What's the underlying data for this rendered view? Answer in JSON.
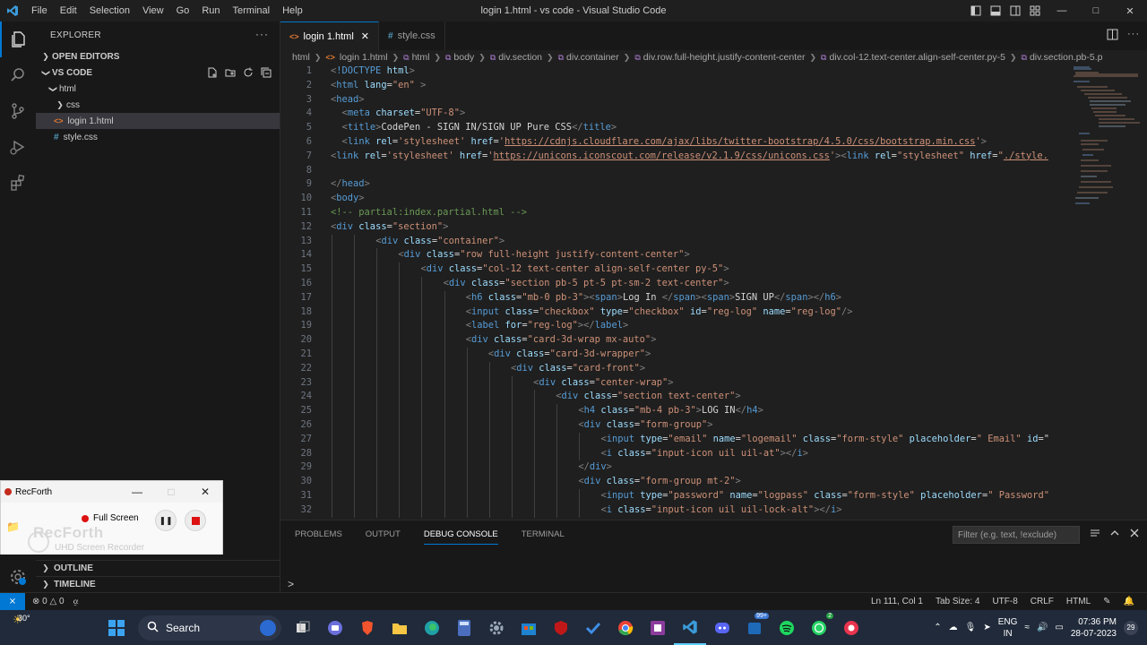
{
  "titlebar": {
    "menu": [
      "File",
      "Edit",
      "Selection",
      "View",
      "Go",
      "Run",
      "Terminal",
      "Help"
    ],
    "title": "login 1.html - vs code - Visual Studio Code"
  },
  "sidebar": {
    "header": "EXPLORER",
    "open_editors": "OPEN EDITORS",
    "folder": "VS CODE",
    "tree": [
      {
        "label": "html",
        "indent": 1,
        "kind": "folder-open"
      },
      {
        "label": "css",
        "indent": 2,
        "kind": "folder-closed"
      },
      {
        "label": "login 1.html",
        "indent": 2,
        "kind": "html"
      },
      {
        "label": "style.css",
        "indent": 1,
        "kind": "css"
      }
    ],
    "outline": "OUTLINE",
    "timeline": "TIMELINE"
  },
  "tabs": [
    {
      "label": "login 1.html",
      "icon": "html",
      "active": true
    },
    {
      "label": "style.css",
      "icon": "css",
      "active": false
    }
  ],
  "breadcrumb": [
    "html",
    "login 1.html",
    "html",
    "body",
    "div.section",
    "div.container",
    "div.row.full-height.justify-content-center",
    "div.col-12.text-center.align-self-center.py-5",
    "div.section.pb-5.p"
  ],
  "code_lines": [
    {
      "n": "1",
      "ind": 0,
      "tk": [
        [
          "p",
          "<"
        ],
        [
          "t",
          "!DOCTYPE "
        ],
        [
          "a",
          "html"
        ],
        [
          "p",
          ">"
        ]
      ]
    },
    {
      "n": "2",
      "ind": 0,
      "tk": [
        [
          "p",
          "<"
        ],
        [
          "t",
          "html "
        ],
        [
          "a",
          "lang"
        ],
        [
          "x",
          "="
        ],
        [
          "s",
          "\"en\""
        ],
        [
          "p",
          " >"
        ]
      ]
    },
    {
      "n": "3",
      "ind": 0,
      "tk": [
        [
          "p",
          "<"
        ],
        [
          "t",
          "head"
        ],
        [
          "p",
          ">"
        ]
      ]
    },
    {
      "n": "4",
      "ind": 1,
      "tk": [
        [
          "p",
          "<"
        ],
        [
          "t",
          "meta "
        ],
        [
          "a",
          "charset"
        ],
        [
          "x",
          "="
        ],
        [
          "s",
          "\"UTF-8\""
        ],
        [
          "p",
          ">"
        ]
      ]
    },
    {
      "n": "5",
      "ind": 1,
      "tk": [
        [
          "p",
          "<"
        ],
        [
          "t",
          "title"
        ],
        [
          "p",
          ">"
        ],
        [
          "x",
          "CodePen - SIGN IN/SIGN UP Pure CSS"
        ],
        [
          "p",
          "</"
        ],
        [
          "t",
          "title"
        ],
        [
          "p",
          ">"
        ]
      ]
    },
    {
      "n": "6",
      "ind": 1,
      "tk": [
        [
          "p",
          "<"
        ],
        [
          "t",
          "link "
        ],
        [
          "a",
          "rel"
        ],
        [
          "x",
          "="
        ],
        [
          "s",
          "'stylesheet' "
        ],
        [
          "a",
          "href"
        ],
        [
          "x",
          "="
        ],
        [
          "s",
          "'"
        ],
        [
          "u",
          "https://cdnjs.cloudflare.com/ajax/libs/twitter-bootstrap/4.5.0/css/bootstrap.min.css"
        ],
        [
          "s",
          "'"
        ],
        [
          "p",
          ">"
        ]
      ]
    },
    {
      "n": "7",
      "ind": 0,
      "tk": [
        [
          "p",
          "<"
        ],
        [
          "t",
          "link "
        ],
        [
          "a",
          "rel"
        ],
        [
          "x",
          "="
        ],
        [
          "s",
          "'stylesheet' "
        ],
        [
          "a",
          "href"
        ],
        [
          "x",
          "="
        ],
        [
          "s",
          "'"
        ],
        [
          "u",
          "https://unicons.iconscout.com/release/v2.1.9/css/unicons.css"
        ],
        [
          "s",
          "'"
        ],
        [
          "p",
          "><"
        ],
        [
          "t",
          "link "
        ],
        [
          "a",
          "rel"
        ],
        [
          "x",
          "="
        ],
        [
          "s",
          "\"stylesheet\" "
        ],
        [
          "a",
          "href"
        ],
        [
          "x",
          "="
        ],
        [
          "s",
          "\""
        ],
        [
          "u",
          "./style."
        ]
      ]
    },
    {
      "n": "8",
      "ind": 0,
      "tk": []
    },
    {
      "n": "9",
      "ind": 0,
      "tk": [
        [
          "p",
          "</"
        ],
        [
          "t",
          "head"
        ],
        [
          "p",
          ">"
        ]
      ]
    },
    {
      "n": "10",
      "ind": 0,
      "tk": [
        [
          "p",
          "<"
        ],
        [
          "t",
          "body"
        ],
        [
          "p",
          ">"
        ]
      ]
    },
    {
      "n": "11",
      "ind": 0,
      "tk": [
        [
          "c",
          "<!-- partial:index.partial.html -->"
        ]
      ]
    },
    {
      "n": "12",
      "ind": 0,
      "tk": [
        [
          "p",
          "<"
        ],
        [
          "t",
          "div "
        ],
        [
          "a",
          "class"
        ],
        [
          "x",
          "="
        ],
        [
          "s",
          "\"section\""
        ],
        [
          "p",
          ">"
        ]
      ]
    },
    {
      "n": "13",
      "ind": 4,
      "tk": [
        [
          "p",
          "<"
        ],
        [
          "t",
          "div "
        ],
        [
          "a",
          "class"
        ],
        [
          "x",
          "="
        ],
        [
          "s",
          "\"container\""
        ],
        [
          "p",
          ">"
        ]
      ]
    },
    {
      "n": "14",
      "ind": 6,
      "tk": [
        [
          "p",
          "<"
        ],
        [
          "t",
          "div "
        ],
        [
          "a",
          "class"
        ],
        [
          "x",
          "="
        ],
        [
          "s",
          "\"row full-height justify-content-center\""
        ],
        [
          "p",
          ">"
        ]
      ]
    },
    {
      "n": "15",
      "ind": 8,
      "tk": [
        [
          "p",
          "<"
        ],
        [
          "t",
          "div "
        ],
        [
          "a",
          "class"
        ],
        [
          "x",
          "="
        ],
        [
          "s",
          "\"col-12 text-center align-self-center py-5\""
        ],
        [
          "p",
          ">"
        ]
      ]
    },
    {
      "n": "16",
      "ind": 10,
      "tk": [
        [
          "p",
          "<"
        ],
        [
          "t",
          "div "
        ],
        [
          "a",
          "class"
        ],
        [
          "x",
          "="
        ],
        [
          "s",
          "\"section pb-5 pt-5 pt-sm-2 text-center\""
        ],
        [
          "p",
          ">"
        ]
      ]
    },
    {
      "n": "17",
      "ind": 12,
      "tk": [
        [
          "p",
          "<"
        ],
        [
          "t",
          "h6 "
        ],
        [
          "a",
          "class"
        ],
        [
          "x",
          "="
        ],
        [
          "s",
          "\"mb-0 pb-3\""
        ],
        [
          "p",
          "><"
        ],
        [
          "t",
          "span"
        ],
        [
          "p",
          ">"
        ],
        [
          "x",
          "Log In "
        ],
        [
          "p",
          "</"
        ],
        [
          "t",
          "span"
        ],
        [
          "p",
          "><"
        ],
        [
          "t",
          "span"
        ],
        [
          "p",
          ">"
        ],
        [
          "x",
          "SIGN UP"
        ],
        [
          "p",
          "</"
        ],
        [
          "t",
          "span"
        ],
        [
          "p",
          "></"
        ],
        [
          "t",
          "h6"
        ],
        [
          "p",
          ">"
        ]
      ]
    },
    {
      "n": "18",
      "ind": 12,
      "tk": [
        [
          "p",
          "<"
        ],
        [
          "t",
          "input "
        ],
        [
          "a",
          "class"
        ],
        [
          "x",
          "="
        ],
        [
          "s",
          "\"checkbox\" "
        ],
        [
          "a",
          "type"
        ],
        [
          "x",
          "="
        ],
        [
          "s",
          "\"checkbox\" "
        ],
        [
          "a",
          "id"
        ],
        [
          "x",
          "="
        ],
        [
          "s",
          "\"reg-log\" "
        ],
        [
          "a",
          "name"
        ],
        [
          "x",
          "="
        ],
        [
          "s",
          "\"reg-log\""
        ],
        [
          "p",
          "/>"
        ]
      ]
    },
    {
      "n": "19",
      "ind": 12,
      "tk": [
        [
          "p",
          "<"
        ],
        [
          "t",
          "label "
        ],
        [
          "a",
          "for"
        ],
        [
          "x",
          "="
        ],
        [
          "s",
          "\"reg-log\""
        ],
        [
          "p",
          "></"
        ],
        [
          "t",
          "label"
        ],
        [
          "p",
          ">"
        ]
      ]
    },
    {
      "n": "20",
      "ind": 12,
      "tk": [
        [
          "p",
          "<"
        ],
        [
          "t",
          "div "
        ],
        [
          "a",
          "class"
        ],
        [
          "x",
          "="
        ],
        [
          "s",
          "\"card-3d-wrap mx-auto\""
        ],
        [
          "p",
          ">"
        ]
      ]
    },
    {
      "n": "21",
      "ind": 14,
      "tk": [
        [
          "p",
          "<"
        ],
        [
          "t",
          "div "
        ],
        [
          "a",
          "class"
        ],
        [
          "x",
          "="
        ],
        [
          "s",
          "\"card-3d-wrapper\""
        ],
        [
          "p",
          ">"
        ]
      ]
    },
    {
      "n": "22",
      "ind": 16,
      "tk": [
        [
          "p",
          "<"
        ],
        [
          "t",
          "div "
        ],
        [
          "a",
          "class"
        ],
        [
          "x",
          "="
        ],
        [
          "s",
          "\"card-front\""
        ],
        [
          "p",
          ">"
        ]
      ]
    },
    {
      "n": "23",
      "ind": 18,
      "tk": [
        [
          "p",
          "<"
        ],
        [
          "t",
          "div "
        ],
        [
          "a",
          "class"
        ],
        [
          "x",
          "="
        ],
        [
          "s",
          "\"center-wrap\""
        ],
        [
          "p",
          ">"
        ]
      ]
    },
    {
      "n": "24",
      "ind": 20,
      "tk": [
        [
          "p",
          "<"
        ],
        [
          "t",
          "div "
        ],
        [
          "a",
          "class"
        ],
        [
          "x",
          "="
        ],
        [
          "s",
          "\"section text-center\""
        ],
        [
          "p",
          ">"
        ]
      ]
    },
    {
      "n": "25",
      "ind": 22,
      "tk": [
        [
          "p",
          "<"
        ],
        [
          "t",
          "h4 "
        ],
        [
          "a",
          "class"
        ],
        [
          "x",
          "="
        ],
        [
          "s",
          "\"mb-4 pb-3\""
        ],
        [
          "p",
          ">"
        ],
        [
          "x",
          "LOG IN"
        ],
        [
          "p",
          "</"
        ],
        [
          "t",
          "h4"
        ],
        [
          "p",
          ">"
        ]
      ]
    },
    {
      "n": "26",
      "ind": 22,
      "tk": [
        [
          "p",
          "<"
        ],
        [
          "t",
          "div "
        ],
        [
          "a",
          "class"
        ],
        [
          "x",
          "="
        ],
        [
          "s",
          "\"form-group\""
        ],
        [
          "p",
          ">"
        ]
      ]
    },
    {
      "n": "27",
      "ind": 24,
      "tk": [
        [
          "p",
          "<"
        ],
        [
          "t",
          "input "
        ],
        [
          "a",
          "type"
        ],
        [
          "x",
          "="
        ],
        [
          "s",
          "\"email\" "
        ],
        [
          "a",
          "name"
        ],
        [
          "x",
          "="
        ],
        [
          "s",
          "\"logemail\" "
        ],
        [
          "a",
          "class"
        ],
        [
          "x",
          "="
        ],
        [
          "s",
          "\"form-style\" "
        ],
        [
          "a",
          "placeholder"
        ],
        [
          "x",
          "="
        ],
        [
          "s",
          "\" Email\" "
        ],
        [
          "a",
          "id"
        ],
        [
          "x",
          "=\""
        ]
      ]
    },
    {
      "n": "28",
      "ind": 24,
      "tk": [
        [
          "p",
          "<"
        ],
        [
          "t",
          "i "
        ],
        [
          "a",
          "class"
        ],
        [
          "x",
          "="
        ],
        [
          "s",
          "\"input-icon uil uil-at\""
        ],
        [
          "p",
          "></"
        ],
        [
          "t",
          "i"
        ],
        [
          "p",
          ">"
        ]
      ]
    },
    {
      "n": "29",
      "ind": 22,
      "tk": [
        [
          "p",
          "</"
        ],
        [
          "t",
          "div"
        ],
        [
          "p",
          ">"
        ]
      ]
    },
    {
      "n": "30",
      "ind": 22,
      "tk": [
        [
          "p",
          "<"
        ],
        [
          "t",
          "div "
        ],
        [
          "a",
          "class"
        ],
        [
          "x",
          "="
        ],
        [
          "s",
          "\"form-group mt-2\""
        ],
        [
          "p",
          ">"
        ]
      ]
    },
    {
      "n": "31",
      "ind": 24,
      "tk": [
        [
          "p",
          "<"
        ],
        [
          "t",
          "input "
        ],
        [
          "a",
          "type"
        ],
        [
          "x",
          "="
        ],
        [
          "s",
          "\"password\" "
        ],
        [
          "a",
          "name"
        ],
        [
          "x",
          "="
        ],
        [
          "s",
          "\"logpass\" "
        ],
        [
          "a",
          "class"
        ],
        [
          "x",
          "="
        ],
        [
          "s",
          "\"form-style\" "
        ],
        [
          "a",
          "placeholder"
        ],
        [
          "x",
          "="
        ],
        [
          "s",
          "\" Password\""
        ]
      ]
    },
    {
      "n": "32",
      "ind": 24,
      "tk": [
        [
          "p",
          "<"
        ],
        [
          "t",
          "i "
        ],
        [
          "a",
          "class"
        ],
        [
          "x",
          "="
        ],
        [
          "s",
          "\"input-icon uil uil-lock-alt\""
        ],
        [
          "p",
          "></"
        ],
        [
          "t",
          "i"
        ],
        [
          "p",
          ">"
        ]
      ]
    }
  ],
  "panel": {
    "tabs": [
      "PROBLEMS",
      "OUTPUT",
      "DEBUG CONSOLE",
      "TERMINAL"
    ],
    "active_tab": "DEBUG CONSOLE",
    "filter_placeholder": "Filter (e.g. text, !exclude)",
    "prompt": ">"
  },
  "statusbar": {
    "errors": "0",
    "warnings": "0",
    "position": "Ln 111, Col 1",
    "tab_size": "Tab Size: 4",
    "encoding": "UTF-8",
    "eol": "CRLF",
    "language": "HTML"
  },
  "recforth": {
    "title": "RecForth",
    "mode": "Full Screen",
    "brand": "RecForth",
    "subtitle": "UHD Screen Recorder",
    "record_color": "#d11111"
  },
  "taskbar": {
    "temperature": "30°",
    "search": "Search",
    "lang_top": "ENG",
    "lang_bottom": "IN",
    "time": "07:36 PM",
    "date": "28-07-2023",
    "notifications": "29",
    "badge_teams": "99+",
    "badge_whatsapp": "2"
  },
  "colors": {
    "accent": "#0078d4",
    "editor_bg": "#1f1f1f",
    "sidebar_bg": "#181818"
  }
}
